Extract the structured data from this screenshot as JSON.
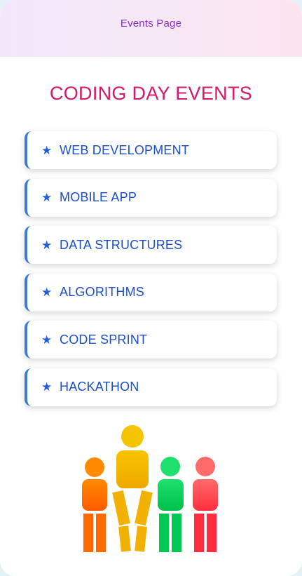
{
  "header": {
    "title": "Events Page"
  },
  "page": {
    "title": "CODING DAY EVENTS"
  },
  "events": [
    {
      "icon": "star-icon",
      "label": "WEB DEVELOPMENT"
    },
    {
      "icon": "star-icon",
      "label": "MOBILE APP"
    },
    {
      "icon": "star-icon",
      "label": "DATA STRUCTURES"
    },
    {
      "icon": "star-icon",
      "label": "ALGORITHMS"
    },
    {
      "icon": "star-icon",
      "label": "CODE SPRINT"
    },
    {
      "icon": "star-icon",
      "label": "HACKATHON"
    }
  ],
  "colors": {
    "header_text": "#8b2bd6",
    "title": "#d3186d",
    "event_text": "#1c4fc8",
    "event_accent": "#3a7bd5",
    "person_orange": "#ff6a00",
    "person_yellow": "#f2b100",
    "person_green": "#00c853",
    "person_red": "#ff2d3d"
  }
}
